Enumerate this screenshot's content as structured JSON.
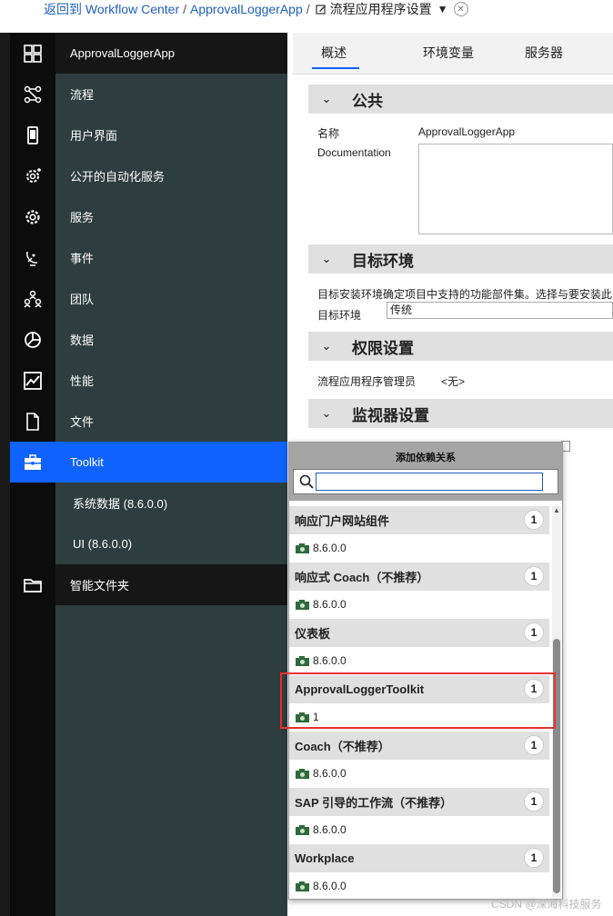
{
  "breadcrumb": {
    "back_link": "返回到 Workflow Center",
    "app_link": "ApprovalLoggerApp",
    "sep": "/",
    "current": "流程应用程序设置"
  },
  "sidebar": {
    "items": [
      {
        "label": "ApprovalLoggerApp",
        "icon": "grid-icon"
      },
      {
        "label": "流程",
        "icon": "flow-icon"
      },
      {
        "label": "用户界面",
        "icon": "phone-icon"
      },
      {
        "label": "公开的自动化服务",
        "icon": "gear-share-icon"
      },
      {
        "label": "服务",
        "icon": "gear-icon"
      },
      {
        "label": "事件",
        "icon": "satellite-dish-icon"
      },
      {
        "label": "团队",
        "icon": "team-icon"
      },
      {
        "label": "数据",
        "icon": "pie-icon"
      },
      {
        "label": "性能",
        "icon": "chart-icon"
      },
      {
        "label": "文件",
        "icon": "file-icon"
      },
      {
        "label": "Toolkit",
        "icon": "toolbox-icon"
      },
      {
        "label": "系统数据 (8.6.0.0)",
        "icon": ""
      },
      {
        "label": "UI (8.6.0.0)",
        "icon": ""
      },
      {
        "label": "智能文件夹",
        "icon": "folder-icon"
      }
    ]
  },
  "tabs": [
    "概述",
    "环境变量",
    "服务器"
  ],
  "sections": {
    "common": {
      "title": "公共",
      "name_label": "名称",
      "name_value": "ApprovalLoggerApp",
      "doc_label": "Documentation"
    },
    "target": {
      "title": "目标环境",
      "desc": "目标安装环境确定项目中支持的功能部件集。选择与要安装此",
      "env_label": "目标环境",
      "env_value": "传统"
    },
    "perm": {
      "title": "权限设置",
      "admin_label": "流程应用程序管理员",
      "admin_value": "<无>"
    },
    "monitor": {
      "title": "监视器设置"
    }
  },
  "dialog": {
    "title": "添加依赖关系",
    "search_value": "",
    "items": [
      {
        "name": "响应门户网站组件",
        "count": "1",
        "version": "8.6.0.0"
      },
      {
        "name": "响应式 Coach（不推荐）",
        "count": "1",
        "version": "8.6.0.0"
      },
      {
        "name": "仪表板",
        "count": "1",
        "version": "8.6.0.0"
      },
      {
        "name": "ApprovalLoggerToolkit",
        "count": "1",
        "version": "1"
      },
      {
        "name": "Coach（不推荐）",
        "count": "1",
        "version": "8.6.0.0"
      },
      {
        "name": "SAP 引导的工作流（不推荐）",
        "count": "1",
        "version": "8.6.0.0"
      },
      {
        "name": "Workplace",
        "count": "1",
        "version": "8.6.0.0"
      }
    ]
  },
  "watermark": "CSDN @深海科技服务",
  "colors": {
    "accent": "#0f62fe",
    "highlight": "#e53030"
  }
}
